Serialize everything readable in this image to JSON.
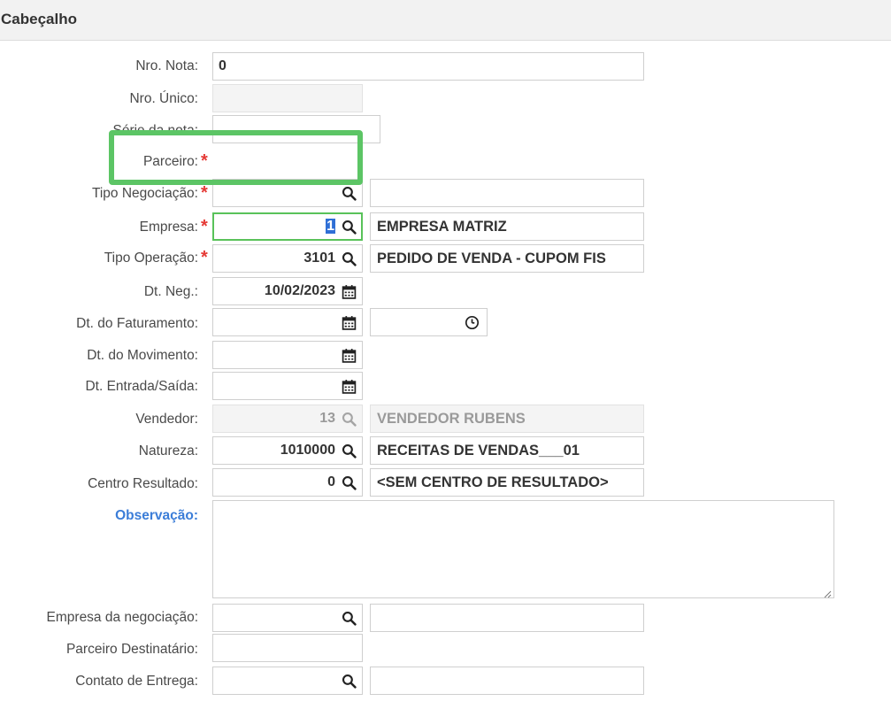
{
  "header": {
    "title": "Cabeçalho"
  },
  "fields": {
    "nro_nota": {
      "label": "Nro. Nota:",
      "value": "0"
    },
    "nro_unico": {
      "label": "Nro. Único:",
      "value": ""
    },
    "serie_nota": {
      "label": "Série da nota:",
      "value": ""
    },
    "parceiro": {
      "label": "Parceiro:",
      "value": ""
    },
    "tipo_negociacao": {
      "label": "Tipo Negociação:",
      "code": "",
      "description": ""
    },
    "empresa": {
      "label": "Empresa:",
      "code": "1",
      "description": "EMPRESA MATRIZ"
    },
    "tipo_operacao": {
      "label": "Tipo Operação:",
      "code": "3101",
      "description": "PEDIDO DE VENDA - CUPOM FIS"
    },
    "dt_neg": {
      "label": "Dt. Neg.:",
      "value": "10/02/2023"
    },
    "dt_faturamento": {
      "label": "Dt. do Faturamento:",
      "date": "",
      "time": ""
    },
    "dt_movimento": {
      "label": "Dt. do Movimento:",
      "value": ""
    },
    "dt_entrada_saida": {
      "label": "Dt. Entrada/Saída:",
      "value": ""
    },
    "vendedor": {
      "label": "Vendedor:",
      "code": "13",
      "description": "VENDEDOR RUBENS"
    },
    "natureza": {
      "label": "Natureza:",
      "code": "1010000",
      "description": "RECEITAS DE VENDAS___01"
    },
    "centro_resultado": {
      "label": "Centro Resultado:",
      "code": "0",
      "description": "<SEM CENTRO DE RESULTADO>"
    },
    "observacao": {
      "label": "Observação:",
      "value": ""
    },
    "empresa_negociacao": {
      "label": "Empresa da negociação:",
      "code": "",
      "description": ""
    },
    "parceiro_destinatario": {
      "label": "Parceiro Destinatário:",
      "value": ""
    },
    "contato_entrega": {
      "label": "Contato de Entrega:",
      "code": "",
      "description": ""
    }
  },
  "required_marker": "*",
  "colors": {
    "required": "#e53935",
    "focus": "#59c25a",
    "highlight": "#5cc565",
    "link_label": "#3b7dd8"
  },
  "icons": {
    "lookup": "search-icon",
    "date": "calendar-icon",
    "time": "clock-icon"
  }
}
